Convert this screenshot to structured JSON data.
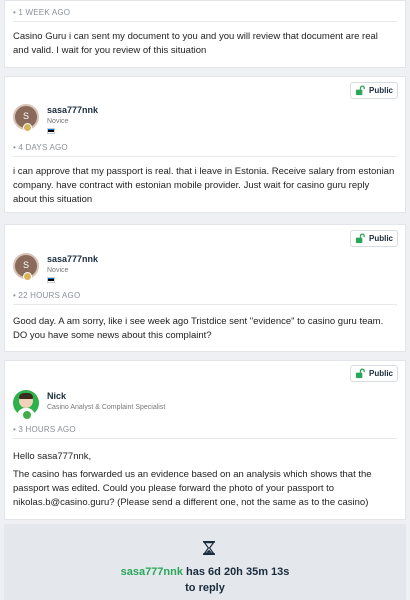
{
  "posts": [
    {
      "time": "• 1 WEEK AGO",
      "text": "Casino Guru i can sent my document to you and you will review that document are real and valid. I wait for you review of this situation"
    },
    {
      "visibility": "Public",
      "user": {
        "name": "sasa777nnk",
        "role": "Novice",
        "initial": "S"
      },
      "time": "• 4 DAYS AGO",
      "text": "i can approve that my passport is real. that i leave in Estonia. Receive salary from estonian company. have contract with estonian mobile provider. Just wait for casino guru reply about this situation"
    },
    {
      "visibility": "Public",
      "user": {
        "name": "sasa777nnk",
        "role": "Novice",
        "initial": "S"
      },
      "time": "• 22 HOURS AGO",
      "text": "Good day. A am sorry, like i see week ago Tristdice sent \"evidence\" to casino guru team. DO you have some news about this complaint?"
    },
    {
      "visibility": "Public",
      "user": {
        "name": "Nick",
        "role": "Casino Analyst & Complaint Specialist"
      },
      "time": "• 3 HOURS AGO",
      "text1": "Hello sasa777nnk,",
      "text2": "The casino has forwarded us an evidence based on an analysis which shows that the passport was edited. Could you please forward the photo of your passport to nikolas.b@casino.guru? (Please send a different one, not the same as to the casino)"
    }
  ],
  "reply_box": {
    "icon": "hourglass-icon",
    "username": "sasa777nnk",
    "countdown": "has 6d 20h 35m 13s",
    "suffix": "to reply"
  },
  "colors": {
    "accent_green": "#2aa65a",
    "flag": [
      "#0072ce",
      "#000000",
      "#ffffff"
    ]
  }
}
